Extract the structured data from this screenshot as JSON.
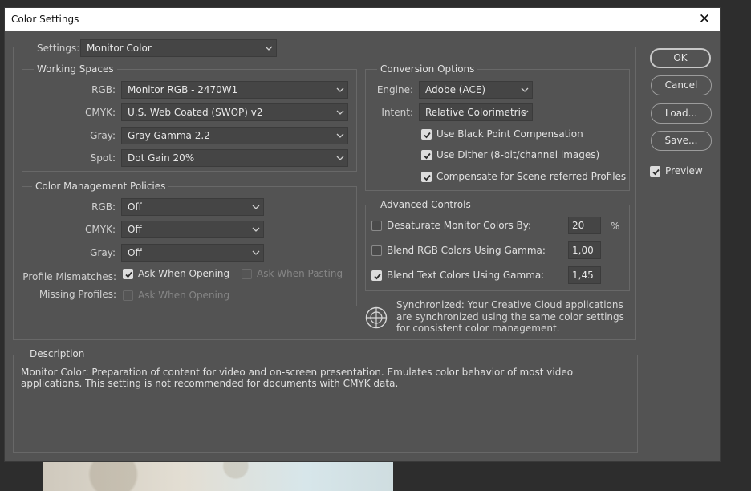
{
  "window": {
    "title": "Color Settings",
    "close_glyph": "✕"
  },
  "settings": {
    "label": "Settings:",
    "value": "Monitor Color"
  },
  "working_spaces": {
    "title": "Working Spaces",
    "rgb": {
      "label": "RGB:",
      "value": "Monitor RGB - 2470W1"
    },
    "cmyk": {
      "label": "CMYK:",
      "value": "U.S. Web Coated (SWOP) v2"
    },
    "gray": {
      "label": "Gray:",
      "value": "Gray Gamma 2.2"
    },
    "spot": {
      "label": "Spot:",
      "value": "Dot Gain 20%"
    }
  },
  "policies": {
    "title": "Color Management Policies",
    "rgb": {
      "label": "RGB:",
      "value": "Off"
    },
    "cmyk": {
      "label": "CMYK:",
      "value": "Off"
    },
    "gray": {
      "label": "Gray:",
      "value": "Off"
    },
    "profile_mismatches": {
      "label": "Profile Mismatches:",
      "ask_opening": "Ask When Opening",
      "ask_opening_checked": true,
      "ask_pasting": "Ask When Pasting",
      "ask_pasting_checked": false
    },
    "missing_profiles": {
      "label": "Missing Profiles:",
      "ask_opening": "Ask When Opening",
      "ask_opening_checked": false
    }
  },
  "conversion": {
    "title": "Conversion Options",
    "engine": {
      "label": "Engine:",
      "value": "Adobe (ACE)"
    },
    "intent": {
      "label": "Intent:",
      "value": "Relative Colorimetric"
    },
    "black_point": {
      "label": "Use Black Point Compensation",
      "checked": true
    },
    "dither": {
      "label": "Use Dither (8-bit/channel images)",
      "checked": true
    },
    "scene_referred": {
      "label": "Compensate for Scene-referred Profiles",
      "checked": true
    }
  },
  "advanced": {
    "title": "Advanced Controls",
    "desaturate": {
      "label": "Desaturate Monitor Colors By:",
      "checked": false,
      "value": "20",
      "unit": "%"
    },
    "blend_rgb": {
      "label": "Blend RGB Colors Using Gamma:",
      "checked": false,
      "value": "1,00"
    },
    "blend_text": {
      "label": "Blend Text Colors Using Gamma:",
      "checked": true,
      "value": "1,45"
    }
  },
  "sync": {
    "icon": "sync-globe-icon",
    "message": "Synchronized: Your Creative Cloud applications are synchronized using the same color settings for consistent color management."
  },
  "description": {
    "title": "Description",
    "text": "Monitor Color:  Preparation of content for video and on-screen presentation. Emulates color behavior of most video applications. This setting is not recommended for documents with CMYK data."
  },
  "buttons": {
    "ok": "OK",
    "cancel": "Cancel",
    "load": "Load...",
    "save": "Save..."
  },
  "preview": {
    "label": "Preview",
    "checked": true
  }
}
